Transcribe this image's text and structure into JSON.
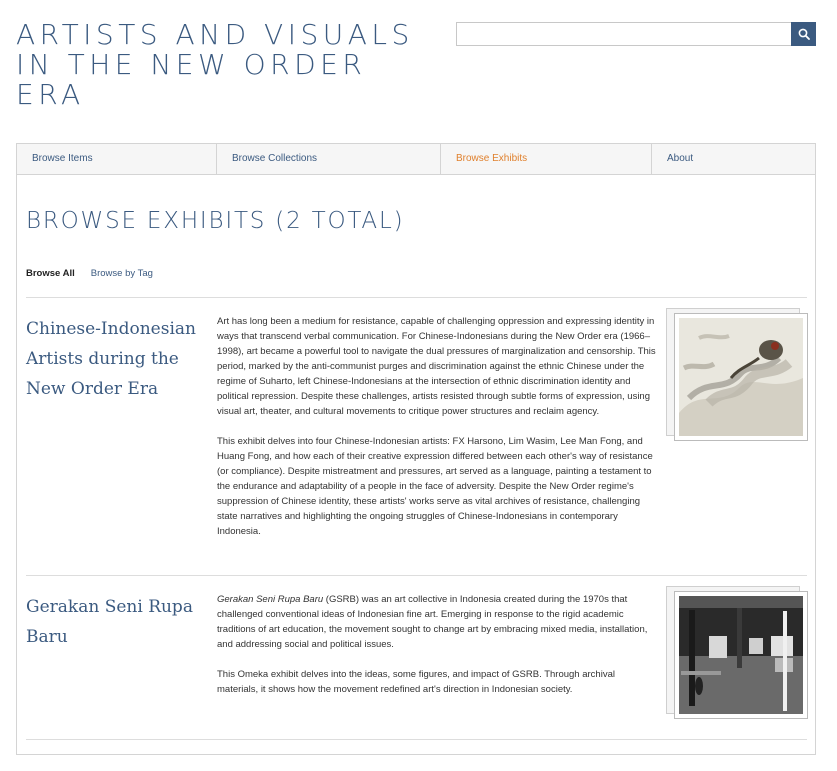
{
  "site": {
    "title": "ARTISTS AND VISUALS IN THE NEW ORDER ERA"
  },
  "search": {
    "placeholder": "",
    "button_icon": "search-icon"
  },
  "nav": {
    "items": [
      {
        "label": "Browse Items",
        "active": false
      },
      {
        "label": "Browse Collections",
        "active": false
      },
      {
        "label": "Browse Exhibits",
        "active": true
      },
      {
        "label": "About",
        "active": false
      }
    ]
  },
  "page": {
    "title": "BROWSE EXHIBITS (2 TOTAL)",
    "subnav": {
      "browse_all": "Browse All",
      "browse_by_tag": "Browse by Tag"
    }
  },
  "exhibits": [
    {
      "title": "Chinese-Indonesian Artists during the New Order Era",
      "paragraphs": [
        "Art has long been a medium for resistance, capable of challenging oppression and expressing identity in ways that transcend verbal communication. For Chinese-Indonesians during the New Order era (1966–1998), art became a powerful tool to navigate the dual pressures of marginalization and censorship. This period, marked by the anti-communist purges and discrimination against the ethnic Chinese under the regime of Suharto, left Chinese-Indonesians at the intersection of ethnic discrimination identity and political repression. Despite these challenges, artists resisted through subtle forms of expression, using visual art, theater, and cultural movements to critique power structures and reclaim agency.",
        "This exhibit delves into four Chinese-Indonesian artists: FX Harsono, Lim Wasim, Lee Man Fong, and Huang Fong, and how each of their creative expression differed between each other's way of resistance (or compliance). Despite mistreatment and pressures, art served as a language, painting a testament to the endurance and adaptability of a people in the face of adversity. Despite the New Order regime's suppression of Chinese identity, these artists' works serve as vital archives of resistance, challenging state narratives and highlighting the ongoing struggles of Chinese-Indonesians in contemporary Indonesia."
      ],
      "thumbnail": "ink painting of a figure riding a dragon among clouds"
    },
    {
      "title": "Gerakan Seni Rupa Baru",
      "p1_italic": "Gerakan Seni Rupa Baru",
      "p1_rest": " (GSRB) was an art collective in Indonesia created during the 1970s that challenged conventional ideas of Indonesian fine art. Emerging in response to the rigid academic traditions of art education, the movement sought to change art by embracing mixed media, installation, and addressing social and political issues.",
      "p2": "This Omeka exhibit delves into the ideas, some figures, and impact of GSRB. Through archival materials, it shows how the movement redefined art's direction in Indonesian society.",
      "thumbnail": "black and white photo of an exhibition hall with people and displayed artworks"
    }
  ],
  "colors": {
    "brand": "#3b5a80",
    "active_nav": "#e0812e"
  }
}
